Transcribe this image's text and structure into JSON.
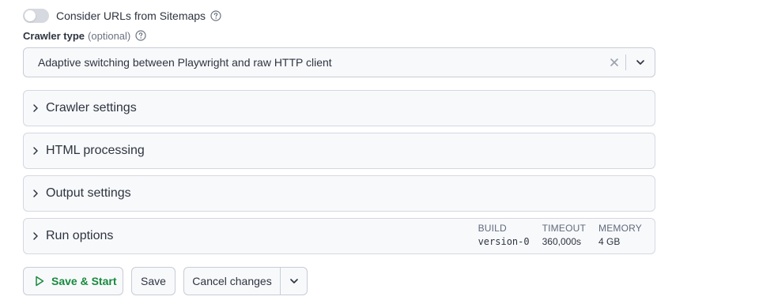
{
  "sitemaps_toggle": {
    "label": "Consider URLs from Sitemaps",
    "enabled": false
  },
  "crawler_type": {
    "label": "Crawler type",
    "optional_label": "(optional)",
    "selected_value": "Adaptive switching between Playwright and raw HTTP client"
  },
  "sections": [
    {
      "title": "Crawler settings"
    },
    {
      "title": "HTML processing"
    },
    {
      "title": "Output settings"
    },
    {
      "title": "Run options"
    }
  ],
  "run_options_meta": {
    "build_label": "BUILD",
    "build_value": "version-0",
    "timeout_label": "TIMEOUT",
    "timeout_value": "360,000s",
    "memory_label": "MEMORY",
    "memory_value": "4 GB"
  },
  "actions": {
    "save_start_label": "Save & Start",
    "save_label": "Save",
    "cancel_label": "Cancel changes"
  },
  "icons": {
    "help": "question-circle-icon",
    "clear": "x-icon",
    "dropdown": "chevron-down-icon",
    "expand": "chevron-right-icon",
    "play": "play-icon"
  },
  "colors": {
    "accent_green": "#178a3d",
    "toggle_off": "#d6d9e0",
    "border": "#c8ccd6"
  }
}
